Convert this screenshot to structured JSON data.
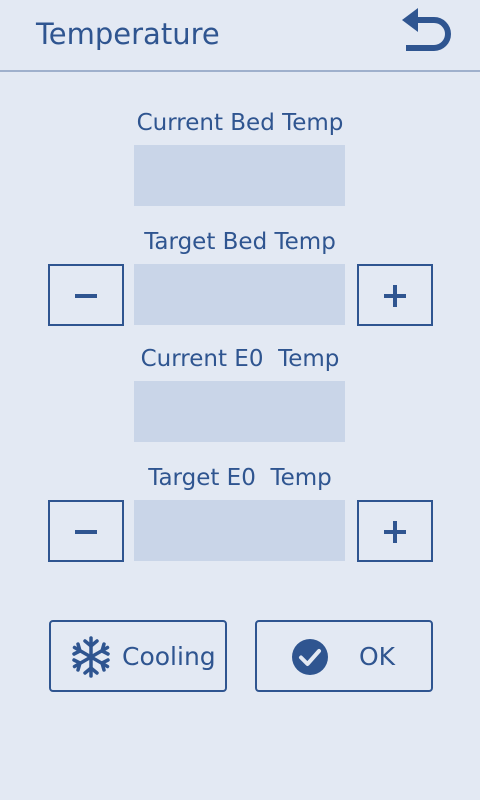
{
  "header": {
    "title": "Temperature",
    "back_icon": "undo-arrow-icon"
  },
  "sections": {
    "current_bed": {
      "label": "Current Bed Temp",
      "value": ""
    },
    "target_bed": {
      "label": "Target Bed Temp",
      "value": ""
    },
    "current_e0": {
      "label": "Current E0  Temp",
      "value": ""
    },
    "target_e0": {
      "label": "Target E0  Temp",
      "value": ""
    }
  },
  "steppers": {
    "minus_icon": "minus-icon",
    "plus_icon": "plus-icon"
  },
  "actions": {
    "cooling_label": "Cooling",
    "cooling_icon": "snowflake-icon",
    "ok_label": "OK",
    "ok_icon": "check-circle-icon"
  },
  "colors": {
    "background": "#e3e9f3",
    "primary": "#2f5590",
    "field_fill": "#c9d5e8",
    "divider": "#9fb0cc"
  }
}
